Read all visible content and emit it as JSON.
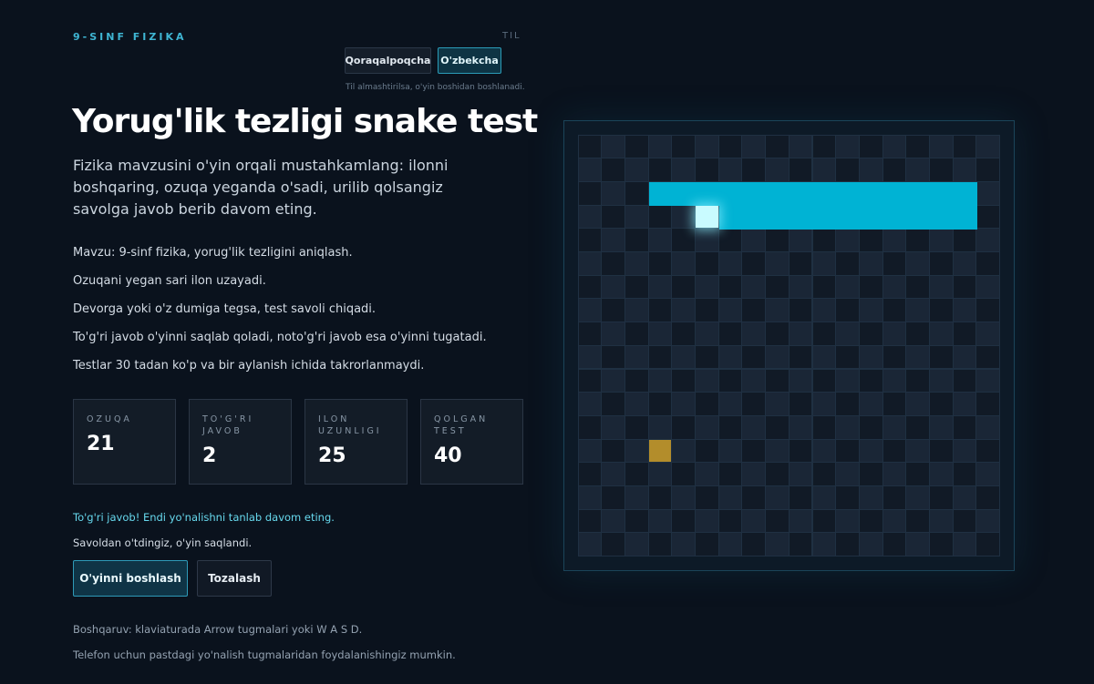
{
  "header": {
    "kicker": "9-SINF FIZIKA",
    "lang_label": "TIL",
    "languages": [
      "Qoraqalpoqcha",
      "O'zbekcha"
    ],
    "selected_language": "O'zbekcha",
    "lang_note": "Til almashtirilsa, o'yin boshidan boshlanadi."
  },
  "main": {
    "title": "Yorug'lik tezligi snake test",
    "subtitle": "Fizika mavzusini o'yin orqali mustahkamlang: ilonni boshqaring, ozuqa yeganda o'sadi, urilib qolsangiz savolga javob berib davom eting.",
    "info": [
      "Mavzu: 9-sinf fizika, yorug'lik tezligini aniqlash.",
      "Ozuqani yegan sari ilon uzayadi.",
      "Devorga yoki o'z dumiga tegsa, test savoli chiqadi.",
      "To'g'ri javob o'yinni saqlab qoladi, noto'g'ri javob esa o'yinni tugatadi.",
      "Testlar 30 tadan ko'p va bir aylanish ichida takrorlanmaydi."
    ],
    "stats": [
      {
        "label": "Ozuqa",
        "value": "21"
      },
      {
        "label": "To'g'ri javob",
        "value": "2"
      },
      {
        "label": "Ilon uzunligi",
        "value": "25"
      },
      {
        "label": "Qolgan test",
        "value": "40"
      }
    ],
    "message_ok": "To'g'ri javob! Endi yo'nalishni tanlab davom eting.",
    "message_info": "Savoldan o'tdingiz, o'yin saqlandi.",
    "buttons": {
      "start": "O'yinni boshlash",
      "clear": "Tozalash"
    },
    "help": [
      "Boshqaruv: klaviaturada Arrow tugmalari yoki W A S D.",
      "Telefon uchun pastdagi yo'nalish tugmalaridan foydalanishingiz mumkin."
    ]
  },
  "game": {
    "grid_cols": 18,
    "grid_rows": 18,
    "snake_head": {
      "col": 5,
      "row": 3
    },
    "snake_body": [
      {
        "col": 6,
        "row": 3
      },
      {
        "col": 7,
        "row": 3
      },
      {
        "col": 8,
        "row": 3
      },
      {
        "col": 9,
        "row": 3
      },
      {
        "col": 10,
        "row": 3
      },
      {
        "col": 11,
        "row": 3
      },
      {
        "col": 12,
        "row": 3
      },
      {
        "col": 13,
        "row": 3
      },
      {
        "col": 14,
        "row": 3
      },
      {
        "col": 15,
        "row": 3
      },
      {
        "col": 16,
        "row": 3
      },
      {
        "col": 16,
        "row": 2
      },
      {
        "col": 15,
        "row": 2
      },
      {
        "col": 14,
        "row": 2
      },
      {
        "col": 13,
        "row": 2
      },
      {
        "col": 12,
        "row": 2
      },
      {
        "col": 11,
        "row": 2
      },
      {
        "col": 10,
        "row": 2
      },
      {
        "col": 9,
        "row": 2
      },
      {
        "col": 8,
        "row": 2
      },
      {
        "col": 7,
        "row": 2
      },
      {
        "col": 6,
        "row": 2
      },
      {
        "col": 5,
        "row": 2
      },
      {
        "col": 4,
        "row": 2
      },
      {
        "col": 3,
        "row": 2
      }
    ],
    "food": {
      "col": 3,
      "row": 13
    },
    "colors": {
      "cell_dark": "#111a26",
      "cell_light": "#1a2636",
      "snake": "#00b3d4",
      "head": "#c9fbff",
      "food": "#b38d2b"
    }
  }
}
